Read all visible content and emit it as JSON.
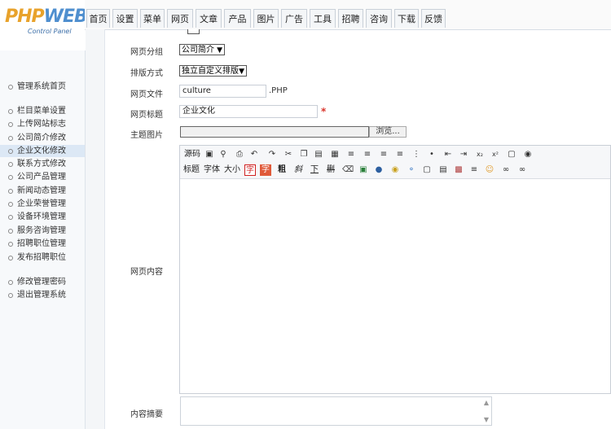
{
  "logo": {
    "brand_php": "PHP",
    "brand_web": "WEB",
    "subtitle": "Control Panel"
  },
  "tabs": [
    "首页",
    "设置",
    "菜单",
    "网页",
    "文章",
    "产品",
    "图片",
    "广告",
    "工具",
    "招聘",
    "咨询",
    "下载",
    "反馈"
  ],
  "sidebar": {
    "items": [
      "管理系统首页",
      "栏目菜单设置",
      "上传网站标志",
      "公司简介修改",
      "企业文化修改",
      "联系方式修改",
      "公司产品管理",
      "新闻动态管理",
      "企业荣誉管理",
      "设备环境管理",
      "服务咨询管理",
      "招聘职位管理",
      "发布招聘职位",
      "修改管理密码",
      "退出管理系统"
    ],
    "active_index": 4
  },
  "form": {
    "group_label": "网页分组",
    "group_value": "公司简介",
    "sort_label": "排版方式",
    "sort_value": "独立自定义排版",
    "file_label": "网页文件",
    "file_value": "culture",
    "file_suffix": ".PHP",
    "title_label": "网页标题",
    "title_value": "企业文化",
    "required_mark": "*",
    "image_label": "主题图片",
    "browse_label": "浏览...",
    "content_label": "网页内容",
    "summary_label": "内容摘要"
  },
  "editor": {
    "row1_text": [
      "源码"
    ],
    "row2_text": [
      "标题",
      "字体",
      "大小",
      "字",
      "字",
      "粗",
      "斜",
      "下",
      "删"
    ],
    "icons_row1": [
      "preview-icon",
      "find-icon",
      "print-icon",
      "spellcheck-icon",
      "undo-icon",
      "redo-icon",
      "cut-icon",
      "copy-icon",
      "paste-icon",
      "table-icon",
      "align-left-icon",
      "align-center-icon",
      "align-right-icon",
      "justify-icon",
      "ordered-list-icon",
      "unordered-list-icon",
      "outdent-icon",
      "indent-icon",
      "subscript-icon",
      "superscript-icon",
      "paste-word-icon",
      "about-icon"
    ],
    "icons_row2": [
      "erase-icon",
      "image-icon",
      "flash-icon",
      "media-icon",
      "comment-icon",
      "select-all-icon",
      "frame-icon",
      "layer-icon",
      "hr-icon",
      "emoticon-icon",
      "link-icon",
      "unlink-icon"
    ]
  }
}
